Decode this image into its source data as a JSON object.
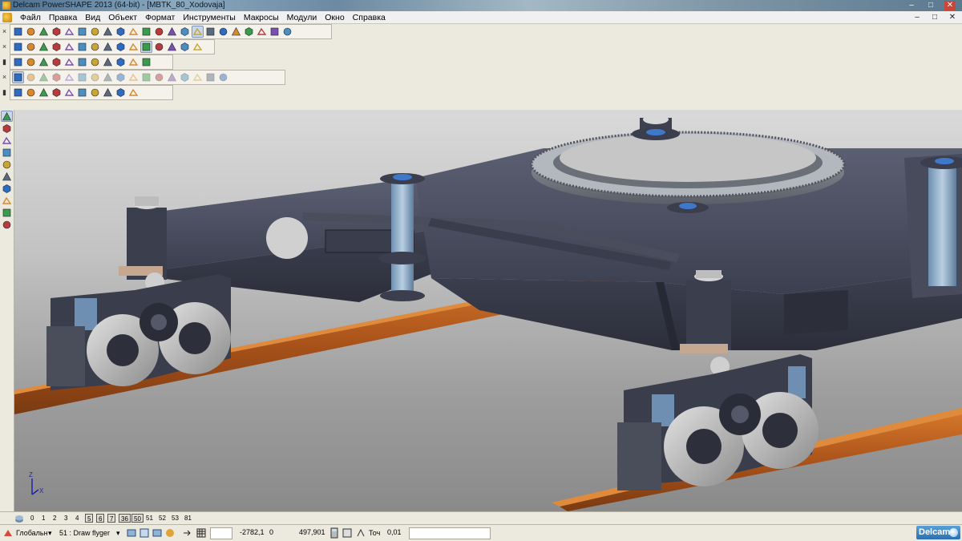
{
  "window": {
    "title": "Delcam PowerSHAPE 2013 (64-bit) - [MBTK_80_Xodovaja]",
    "controls": [
      "–",
      "□",
      "✕"
    ]
  },
  "menu": {
    "items": [
      "Файл",
      "Правка",
      "Вид",
      "Объект",
      "Формат",
      "Инструменты",
      "Макросы",
      "Модули",
      "Окно",
      "Справка"
    ],
    "mdi_controls": [
      "–",
      "□",
      "✕"
    ]
  },
  "toolbars": {
    "row1_icons": [
      "new-file",
      "open-file",
      "save-file",
      "save-as",
      "print",
      "cut",
      "copy",
      "paste",
      "delete",
      "select-all",
      "undo",
      "redo",
      "dimension",
      "wireframe",
      "select-cursor",
      "circle-select",
      "lasso",
      "drag",
      "workplane",
      "measure",
      "snap",
      "magic-wand"
    ],
    "row2_icons": [
      "view-top",
      "view-front",
      "view-side",
      "view-iso",
      "zoom-window",
      "zoom-all",
      "pan",
      "zoom-in",
      "zoom-out",
      "rotate",
      "shaded",
      "wire-shaded",
      "render",
      "lighting",
      "grid"
    ],
    "row3_icons": [
      "surface-plane",
      "surface-sphere",
      "surface-cone",
      "surface-torus",
      "surface-extrude",
      "surface-revolve",
      "primitive-block",
      "primitive-cylinder",
      "boolean",
      "fillet",
      "blend"
    ],
    "row4_icons": [
      "solid-block",
      "solid-cylinder",
      "solid-cone",
      "solid-sphere",
      "solid-torus",
      "solid-spring",
      "extrude",
      "revolve",
      "drive",
      "sweep",
      "fillet",
      "chamfer",
      "shell",
      "boolean-add",
      "boolean-subtract",
      "boolean-intersect",
      "split"
    ],
    "row5_icons": [
      "assembly",
      "component",
      "section",
      "analyse",
      "mesh",
      "electrode",
      "mold",
      "wireframe-to-solid",
      "surface-analysis",
      "check"
    ],
    "left_icons": [
      "select-arrow",
      "multi-select",
      "line",
      "arc",
      "rectangle",
      "polygon",
      "solid",
      "dimension",
      "curve",
      "edit"
    ]
  },
  "levels": {
    "items": [
      "0",
      "1",
      "2",
      "3",
      "4",
      "5",
      "6",
      "7",
      "36",
      "50",
      "51",
      "52",
      "53",
      "81"
    ],
    "boxed": [
      "5",
      "6",
      "7",
      "36",
      "50"
    ]
  },
  "statusbar": {
    "workplane": "Глобальн",
    "level_select": "51 : Draw flyger",
    "coord_x": "-2782,1",
    "coord_y": "0",
    "coord_z": "497,901",
    "tolerance_label": "Точ",
    "tolerance_value": "0,01",
    "brand": "Delcam"
  },
  "viewport": {
    "axis_x": "X",
    "axis_z": "Z"
  }
}
